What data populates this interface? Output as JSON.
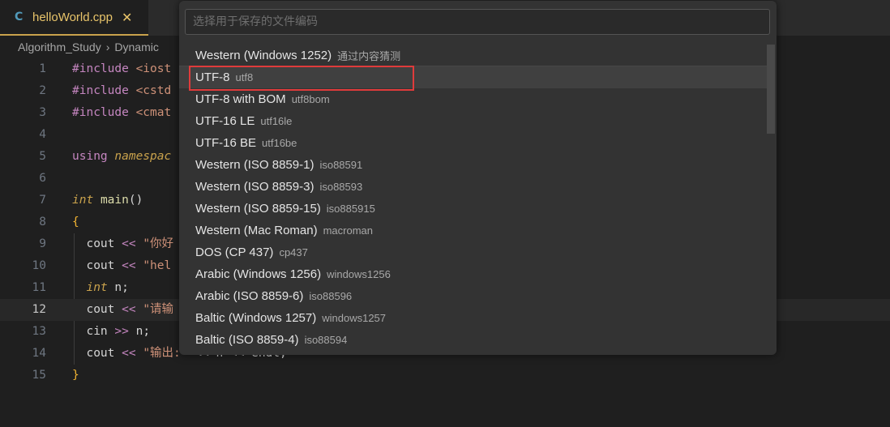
{
  "tab": {
    "icon": "cpp-file-icon",
    "icon_glyph": "C",
    "label": "helloWorld.cpp",
    "close_glyph": "✕"
  },
  "breadcrumb": {
    "segments": [
      "Algorithm_Study",
      "Dynamic"
    ],
    "separator": "›"
  },
  "editor": {
    "lines": [
      {
        "n": "1"
      },
      {
        "n": "2"
      },
      {
        "n": "3"
      },
      {
        "n": "4"
      },
      {
        "n": "5"
      },
      {
        "n": "6"
      },
      {
        "n": "7"
      },
      {
        "n": "8"
      },
      {
        "n": "9"
      },
      {
        "n": "10"
      },
      {
        "n": "11"
      },
      {
        "n": "12"
      },
      {
        "n": "13"
      },
      {
        "n": "14"
      },
      {
        "n": "15"
      }
    ],
    "text": {
      "include": "#include",
      "inc1": "<iost",
      "inc2": "<cstd",
      "inc3": "<cmat",
      "using": "using",
      "namespace": "namespac",
      "int": "int",
      "main": "main",
      "parens": "()",
      "brace_open": "{",
      "brace_close": "}",
      "cout": "cout",
      "cin": "cin",
      "lshift": "<<",
      "rshift": ">>",
      "str9": "\"你好",
      "str10": "\"hel",
      "n_semi": "n;",
      "str12": "\"请输",
      "n_var": "n;",
      "str14": "\"输出:",
      "tail14": "\" << n << endl;"
    }
  },
  "picker": {
    "placeholder": "选择用于保存的文件编码",
    "items": [
      {
        "label": "Western (Windows 1252)",
        "desc": "通过内容猜测"
      },
      {
        "label": "UTF-8",
        "desc": "utf8"
      },
      {
        "label": "UTF-8 with BOM",
        "desc": "utf8bom"
      },
      {
        "label": "UTF-16 LE",
        "desc": "utf16le"
      },
      {
        "label": "UTF-16 BE",
        "desc": "utf16be"
      },
      {
        "label": "Western (ISO 8859-1)",
        "desc": "iso88591"
      },
      {
        "label": "Western (ISO 8859-3)",
        "desc": "iso88593"
      },
      {
        "label": "Western (ISO 8859-15)",
        "desc": "iso885915"
      },
      {
        "label": "Western (Mac Roman)",
        "desc": "macroman"
      },
      {
        "label": "DOS (CP 437)",
        "desc": "cp437"
      },
      {
        "label": "Arabic (Windows 1256)",
        "desc": "windows1256"
      },
      {
        "label": "Arabic (ISO 8859-6)",
        "desc": "iso88596"
      },
      {
        "label": "Baltic (Windows 1257)",
        "desc": "windows1257"
      },
      {
        "label": "Baltic (ISO 8859-4)",
        "desc": "iso88594"
      }
    ],
    "focused_index": 1
  },
  "colors": {
    "accent_tab": "#c9a24c",
    "highlight_box": "#e03b3b"
  }
}
